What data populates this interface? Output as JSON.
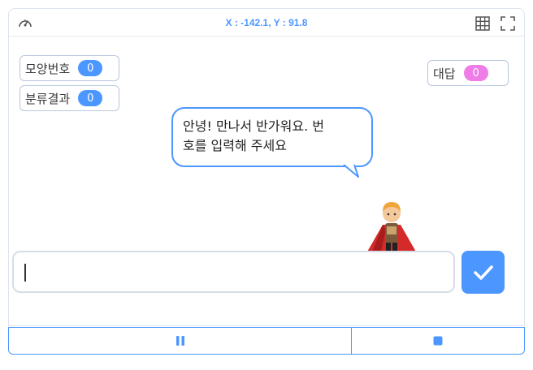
{
  "stage": {
    "coordinates": "X : -142.1, Y : 91.8"
  },
  "monitors": [
    {
      "label": "모양번호",
      "value": "0",
      "color": "#4c97ff"
    },
    {
      "label": "분류결과",
      "value": "0",
      "color": "#4c97ff"
    },
    {
      "label": "대답",
      "value": "0",
      "color": "#ee7de7"
    }
  ],
  "speech_bubble": {
    "line1": "안녕! 만나서 반가워요. 번",
    "line2": "호를 입력해 주세요"
  },
  "answer": {
    "value": ""
  },
  "icons": {
    "speed": "speedometer-icon",
    "grid": "grid-icon",
    "fullscreen": "fullscreen-icon",
    "submit": "checkmark-icon",
    "pause": "pause-icon",
    "stop": "stop-icon"
  },
  "colors": {
    "accent": "#4c97ff",
    "answer_badge": "#ee7de7"
  }
}
